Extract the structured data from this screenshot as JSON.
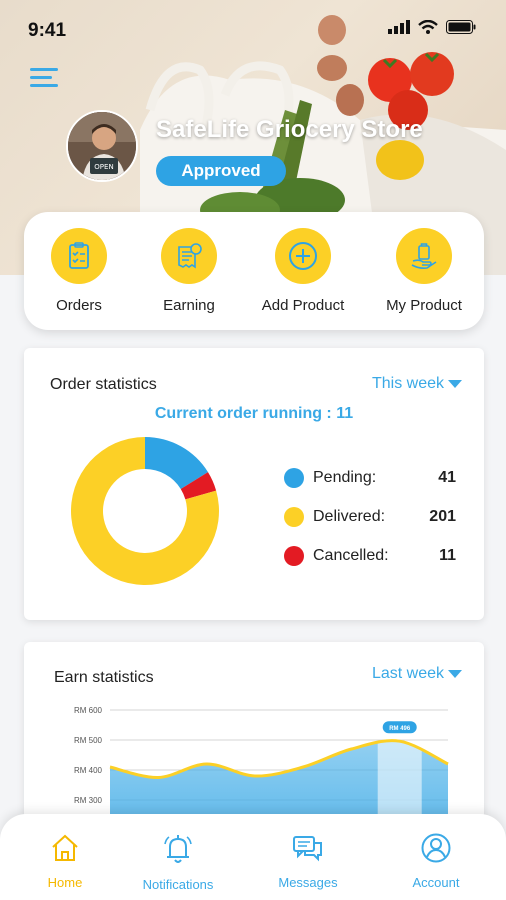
{
  "status_bar": {
    "time": "9:41"
  },
  "store": {
    "name": "SafeLife Griocery Store",
    "status": "Approved"
  },
  "actions": [
    {
      "label": "Orders",
      "icon": "clipboard-list-icon"
    },
    {
      "label": "Earning",
      "icon": "receipt-coin-icon"
    },
    {
      "label": "Add Product",
      "icon": "plus-circle-icon"
    },
    {
      "label": "My Product",
      "icon": "hand-bag-icon"
    }
  ],
  "order_stats": {
    "title": "Order statistics",
    "period": "This week",
    "running": "Current order running : 11",
    "legend": [
      {
        "label": "Pending:",
        "value": "41",
        "color": "#2ea3e4"
      },
      {
        "label": "Delivered:",
        "value": "201",
        "color": "#fcd026"
      },
      {
        "label": "Cancelled:",
        "value": "11",
        "color": "#e31b23"
      }
    ]
  },
  "earn_stats": {
    "title": "Earn statistics",
    "period": "Last week",
    "highlight": "RM 496"
  },
  "chart_data": [
    {
      "type": "pie",
      "categories": [
        "Pending",
        "Delivered",
        "Cancelled"
      ],
      "values": [
        41,
        201,
        11
      ],
      "colors": [
        "#2ea3e4",
        "#fcd026",
        "#e31b23"
      ],
      "title": "Order statistics"
    },
    {
      "type": "area",
      "title": "Earn statistics",
      "y_ticks": [
        "RM 600",
        "RM 500",
        "RM 400",
        "RM 300"
      ],
      "ylim": [
        300,
        600
      ],
      "x": [
        0,
        1,
        2,
        3,
        4,
        5,
        6,
        7
      ],
      "values": [
        410,
        375,
        420,
        380,
        410,
        470,
        496,
        420
      ],
      "highlight_index": 6,
      "highlight_label": "RM 496",
      "color": "#3aa9e6",
      "line_color": "#fcd026"
    }
  ],
  "nav": [
    {
      "label": "Home",
      "icon": "home-icon",
      "active": true
    },
    {
      "label": "Notifications",
      "icon": "bell-icon",
      "active": false
    },
    {
      "label": "Messages",
      "icon": "chat-bubbles-icon",
      "active": false
    },
    {
      "label": "Account",
      "icon": "user-circle-icon",
      "active": false
    }
  ]
}
